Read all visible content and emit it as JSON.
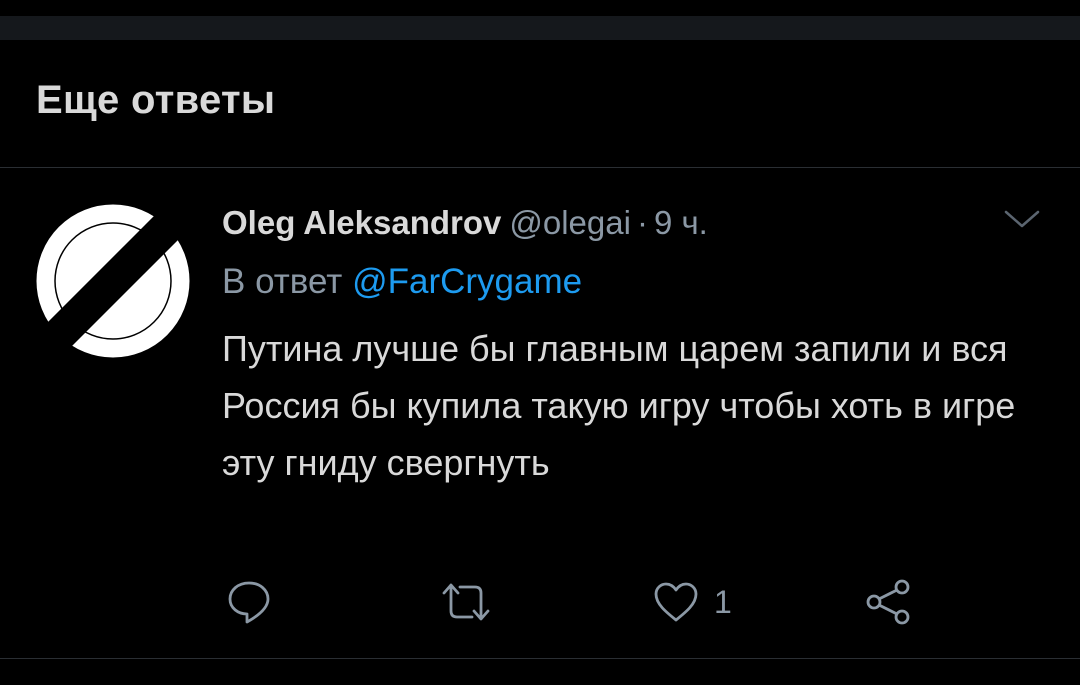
{
  "section": {
    "title": "Еще ответы"
  },
  "tweet": {
    "display_name": "Oleg Aleksandrov",
    "handle": "@olegai",
    "separator": "·",
    "timestamp": "9 ч.",
    "reply_prefix": "В ответ",
    "reply_to": "@FarCrygame",
    "text": "Путина лучше бы главным царем запили и вся Россия бы купила такую игру чтобы хоть в игре эту гниду свергнуть",
    "avatar_icon": "no-entry-sign-avatar",
    "actions": {
      "reply_icon": "reply-icon",
      "retweet_icon": "retweet-icon",
      "like_icon": "heart-icon",
      "like_count": "1",
      "share_icon": "share-icon"
    }
  },
  "colors": {
    "background": "#000000",
    "text": "#d9d9d9",
    "secondary_text": "#8b98a5",
    "link": "#1d9bf0",
    "divider": "#2a2e33"
  }
}
